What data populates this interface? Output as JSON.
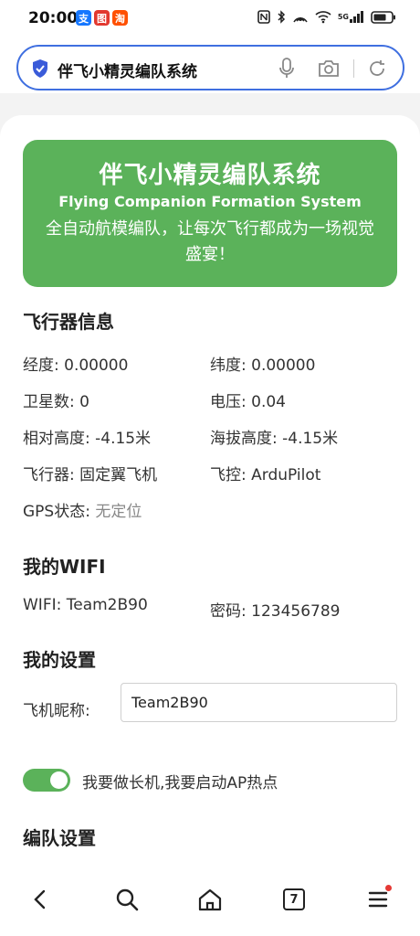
{
  "status_bar": {
    "time": "20:00",
    "app_icons": [
      {
        "name": "alipay-icon",
        "glyph": "支",
        "color": "#1677ff"
      },
      {
        "name": "app-red-icon",
        "glyph": "图",
        "color": "#e2382f"
      },
      {
        "name": "taobao-icon",
        "glyph": "淘",
        "color": "#ff5000"
      }
    ],
    "battery_label": "",
    "signal_label": "5G"
  },
  "address_bar": {
    "url_text": "伴飞小精灵编队系统"
  },
  "hero": {
    "title": "伴飞小精灵编队系统",
    "subtitle": "Flying Companion Formation System",
    "description": "全自动航模编队，让每次飞行都成为一场视觉盛宴！",
    "background_color": "#5bb25a"
  },
  "aircraft_info": {
    "title": "飞行器信息",
    "longitude": "经度: 0.00000",
    "latitude": "纬度: 0.00000",
    "satellites": "卫星数: 0",
    "voltage": "电压: 0.04",
    "relative_altitude": "相对高度: -4.15米",
    "altitude": "海拔高度: -4.15米",
    "aircraft": "飞行器: 固定翼飞机",
    "flight_controller": "飞控: ArduPilot",
    "gps_label": "GPS状态: ",
    "gps_value": "无定位"
  },
  "wifi": {
    "title": "我的WIFI",
    "ssid": "WIFI: Team2B90",
    "password": "密码: 123456789"
  },
  "settings": {
    "title": "我的设置",
    "nickname_label": "飞机昵称:",
    "nickname_value": "Team2B90",
    "leader_toggle_label": "我要做长机,我要启动AP热点",
    "leader_toggle_on": true
  },
  "formation": {
    "title": "编队设置"
  },
  "bottom_nav": {
    "tab_count": "7"
  }
}
